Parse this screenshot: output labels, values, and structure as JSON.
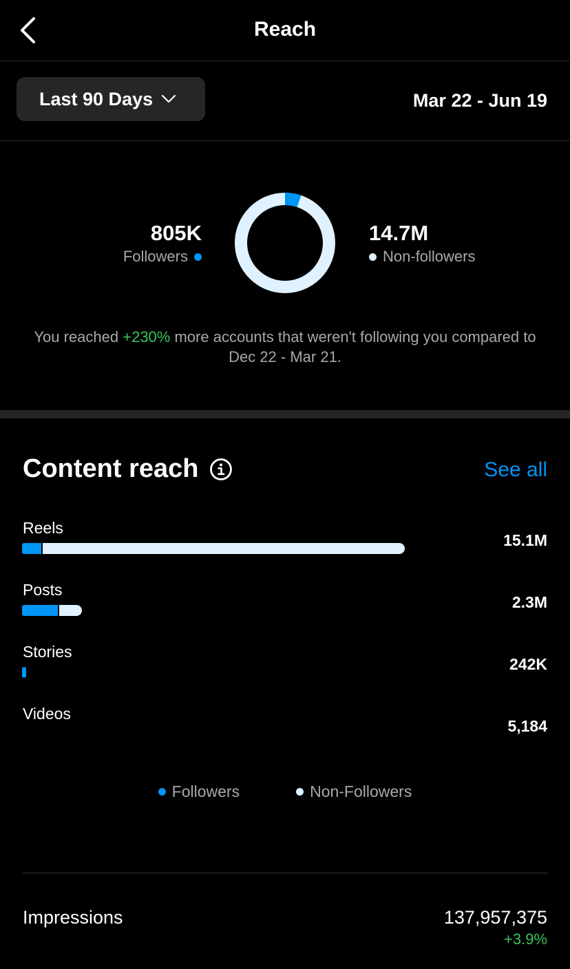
{
  "header": {
    "title": "Reach",
    "back_icon": "chevron-left-icon"
  },
  "range": {
    "selected": "Last 90 Days",
    "dropdown_icon": "chevron-down-icon",
    "dates": "Mar 22 - Jun 19"
  },
  "summary": {
    "followers_value": "805K",
    "followers_label": "Followers",
    "nonfollowers_value": "14.7M",
    "nonfollowers_label": "Non-followers",
    "text_before": "You reached ",
    "text_highlight": "+230%",
    "text_after": " more accounts that weren't following you compared to Dec 22 - Mar 21.",
    "followers_share": 0.052
  },
  "colors": {
    "followers": "#0095f6",
    "non_followers": "#e0f1ff",
    "positive": "#3ac45b",
    "link": "#0095f6"
  },
  "content_reach": {
    "title": "Content reach",
    "info_icon": "info-icon",
    "see_all": "See all",
    "rows": [
      {
        "label": "Reels",
        "value": "15.1M",
        "followers_fraction": 0.05,
        "total_fraction": 1.0
      },
      {
        "label": "Posts",
        "value": "2.3M",
        "followers_fraction": 0.6,
        "total_fraction": 0.157
      },
      {
        "label": "Stories",
        "value": "242K",
        "followers_fraction": 1.0,
        "total_fraction": 0.011
      },
      {
        "label": "Videos",
        "value": "5,184",
        "followers_fraction": 0,
        "total_fraction": 0
      }
    ],
    "legend": {
      "followers": "Followers",
      "non_followers": "Non-Followers"
    }
  },
  "impressions": {
    "label": "Impressions",
    "value": "137,957,375",
    "change": "+3.9%"
  }
}
